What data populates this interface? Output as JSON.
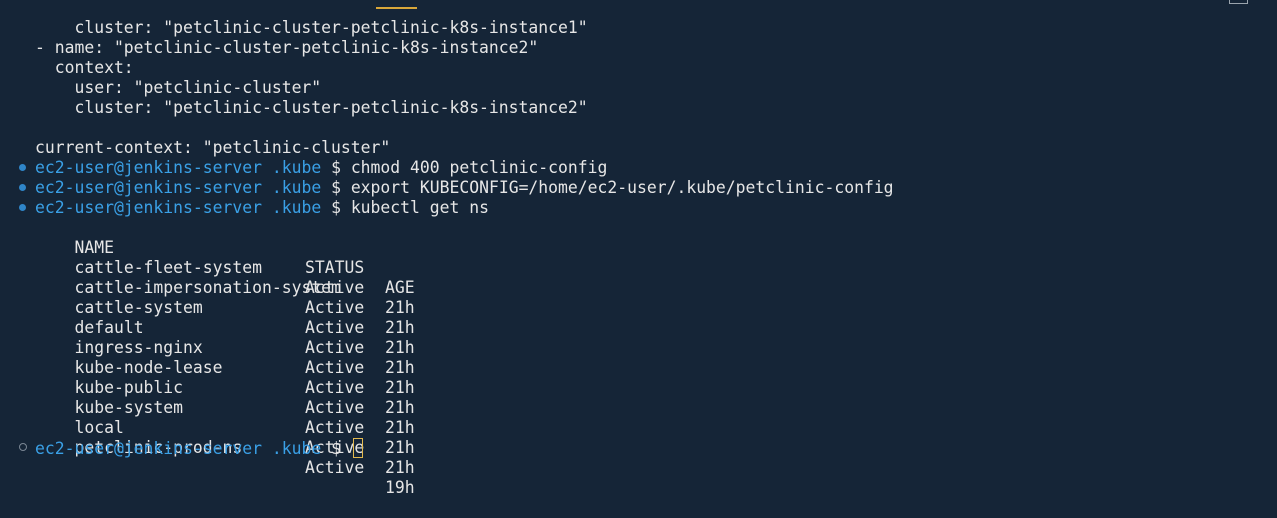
{
  "config_lines": [
    "    cluster: \"petclinic-cluster-petclinic-k8s-instance1\"",
    "- name: \"petclinic-cluster-petclinic-k8s-instance2\"",
    "  context:",
    "    user: \"petclinic-cluster\"",
    "    cluster: \"petclinic-cluster-petclinic-k8s-instance2\"",
    "",
    "current-context: \"petclinic-cluster\""
  ],
  "prompt": {
    "user_host": "ec2-user@jenkins-server",
    "dir": ".kube",
    "symbol": "$"
  },
  "commands": [
    "chmod 400 petclinic-config",
    "export KUBECONFIG=/home/ec2-user/.kube/petclinic-config",
    "kubectl get ns"
  ],
  "ns_table": {
    "headers": [
      "NAME",
      "STATUS",
      "AGE"
    ],
    "rows": [
      [
        "cattle-fleet-system",
        "Active",
        "21h"
      ],
      [
        "cattle-impersonation-system",
        "Active",
        "21h"
      ],
      [
        "cattle-system",
        "Active",
        "21h"
      ],
      [
        "default",
        "Active",
        "21h"
      ],
      [
        "ingress-nginx",
        "Active",
        "21h"
      ],
      [
        "kube-node-lease",
        "Active",
        "21h"
      ],
      [
        "kube-public",
        "Active",
        "21h"
      ],
      [
        "kube-system",
        "Active",
        "21h"
      ],
      [
        "local",
        "Active",
        "21h"
      ],
      [
        "petclinic-prod-ns",
        "Active",
        "19h"
      ]
    ]
  },
  "colors": {
    "background": "#152537",
    "text": "#e6e6e6",
    "prompt_user": "#3aa0e6",
    "indicator_success": "#2f86c9",
    "cursor": "#e2b94f"
  }
}
